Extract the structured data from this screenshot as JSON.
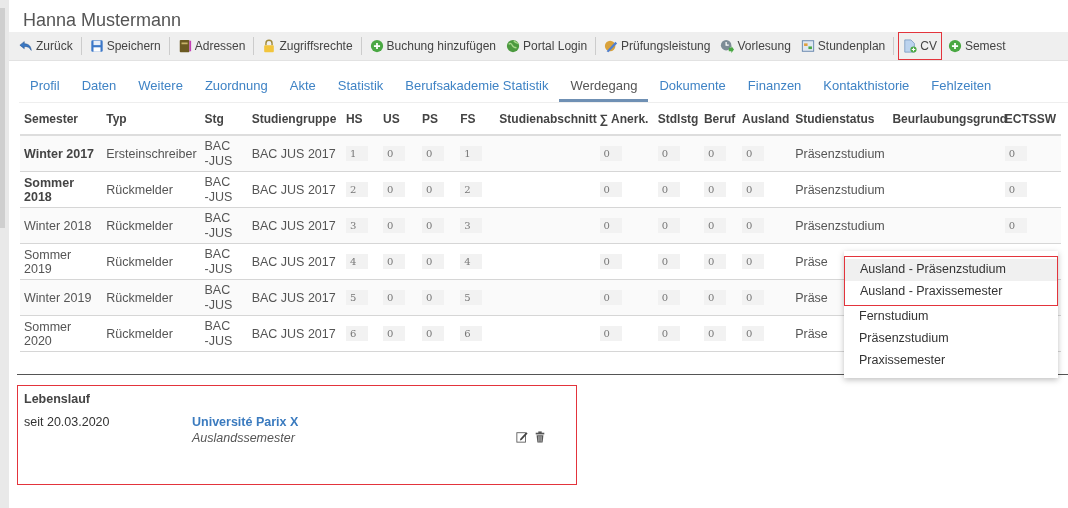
{
  "header": {
    "title": "Hanna Mustermann"
  },
  "toolbar": {
    "groups": [
      [
        {
          "label": "Zurück",
          "kind": "back",
          "highlighted": false
        }
      ],
      [
        {
          "label": "Speichern",
          "kind": "save",
          "highlighted": false
        }
      ],
      [
        {
          "label": "Adressen",
          "kind": "book",
          "highlighted": false
        }
      ],
      [
        {
          "label": "Zugriffsrechte",
          "kind": "lock",
          "highlighted": false
        }
      ],
      [
        {
          "label": "Buchung hinzufügen",
          "kind": "add",
          "highlighted": false
        },
        {
          "label": "Portal Login",
          "kind": "globe",
          "highlighted": false
        }
      ],
      [
        {
          "label": "Prüfungsleistung",
          "kind": "exam",
          "highlighted": false
        },
        {
          "label": "Vorlesung",
          "kind": "lecture",
          "highlighted": false
        },
        {
          "label": "Stundenplan",
          "kind": "calendar",
          "highlighted": false
        }
      ],
      [
        {
          "label": "CV",
          "kind": "document",
          "highlighted": true
        },
        {
          "label": "Semest",
          "kind": "add",
          "highlighted": false
        }
      ]
    ]
  },
  "tabs": [
    {
      "label": "Profil",
      "selected": false
    },
    {
      "label": "Daten",
      "selected": false
    },
    {
      "label": "Weitere",
      "selected": false
    },
    {
      "label": "Zuordnung",
      "selected": false
    },
    {
      "label": "Akte",
      "selected": false
    },
    {
      "label": "Statistik",
      "selected": false
    },
    {
      "label": "Berufsakademie Statistik",
      "selected": false
    },
    {
      "label": "Werdegang",
      "selected": true
    },
    {
      "label": "Dokumente",
      "selected": false
    },
    {
      "label": "Finanzen",
      "selected": false
    },
    {
      "label": "Kontakthistorie",
      "selected": false
    },
    {
      "label": "Fehlzeiten",
      "selected": false
    }
  ],
  "table": {
    "columns": [
      "Semester",
      "Typ",
      "Stg",
      "Studiengruppe",
      "HS",
      "US",
      "PS",
      "FS",
      "Studienabschnitt",
      "∑ Anerk.",
      "Stdlstg",
      "Beruf",
      "Ausland",
      "Studienstatus",
      "Beurlaubungsgrund",
      "ECTSSW"
    ],
    "rows": [
      {
        "semester": "Winter 2017",
        "bold": true,
        "typ": "Ersteinschreiber",
        "stg": "BAC-JUS",
        "studiengruppe": "BAC JUS 2017",
        "hs": "1",
        "us": "0",
        "ps": "0",
        "fs": "1",
        "anerk": "0",
        "stdlstg": "0",
        "beruf": "0",
        "ausland": "0",
        "studienstatus": "Präsenzstudium",
        "ectssw": "0"
      },
      {
        "semester": "Sommer 2018",
        "bold": true,
        "typ": "Rückmelder",
        "stg": "BAC-JUS",
        "studiengruppe": "BAC JUS 2017",
        "hs": "2",
        "us": "0",
        "ps": "0",
        "fs": "2",
        "anerk": "0",
        "stdlstg": "0",
        "beruf": "0",
        "ausland": "0",
        "studienstatus": "Präsenzstudium",
        "ectssw": "0"
      },
      {
        "semester": "Winter 2018",
        "bold": false,
        "typ": "Rückmelder",
        "stg": "BAC-JUS",
        "studiengruppe": "BAC JUS 2017",
        "hs": "3",
        "us": "0",
        "ps": "0",
        "fs": "3",
        "anerk": "0",
        "stdlstg": "0",
        "beruf": "0",
        "ausland": "0",
        "studienstatus": "Präsenzstudium",
        "ectssw": "0"
      },
      {
        "semester": "Sommer 2019",
        "bold": false,
        "typ": "Rückmelder",
        "stg": "BAC-JUS",
        "studiengruppe": "BAC JUS 2017",
        "hs": "4",
        "us": "0",
        "ps": "0",
        "fs": "4",
        "anerk": "0",
        "stdlstg": "0",
        "beruf": "0",
        "ausland": "0",
        "studienstatus": "Präse"
      },
      {
        "semester": "Winter 2019",
        "bold": false,
        "typ": "Rückmelder",
        "stg": "BAC-JUS",
        "studiengruppe": "BAC JUS 2017",
        "hs": "5",
        "us": "0",
        "ps": "0",
        "fs": "5",
        "anerk": "0",
        "stdlstg": "0",
        "beruf": "0",
        "ausland": "0",
        "studienstatus": "Präse"
      },
      {
        "semester": "Sommer 2020",
        "bold": false,
        "typ": "Rückmelder",
        "stg": "BAC-JUS",
        "studiengruppe": "BAC JUS 2017",
        "hs": "6",
        "us": "0",
        "ps": "0",
        "fs": "6",
        "anerk": "0",
        "stdlstg": "0",
        "beruf": "0",
        "ausland": "0",
        "studienstatus": "Präse"
      }
    ]
  },
  "status_dropdown": {
    "options": [
      {
        "label": "Ausland - Präsenzstudium",
        "selected": true,
        "highlighted": true
      },
      {
        "label": "Ausland - Praxissemester",
        "selected": false,
        "highlighted": true
      },
      {
        "label": "Fernstudium",
        "selected": false,
        "highlighted": false
      },
      {
        "label": "Präsenzstudium",
        "selected": false,
        "highlighted": false
      },
      {
        "label": "Praxissemester",
        "selected": false,
        "highlighted": false
      }
    ]
  },
  "lebenslauf": {
    "title": "Lebenslauf",
    "highlighted": true,
    "entries": [
      {
        "date": "seit 20.03.2020",
        "institution": "Université Parix X",
        "type": "Auslandssemester"
      }
    ]
  }
}
